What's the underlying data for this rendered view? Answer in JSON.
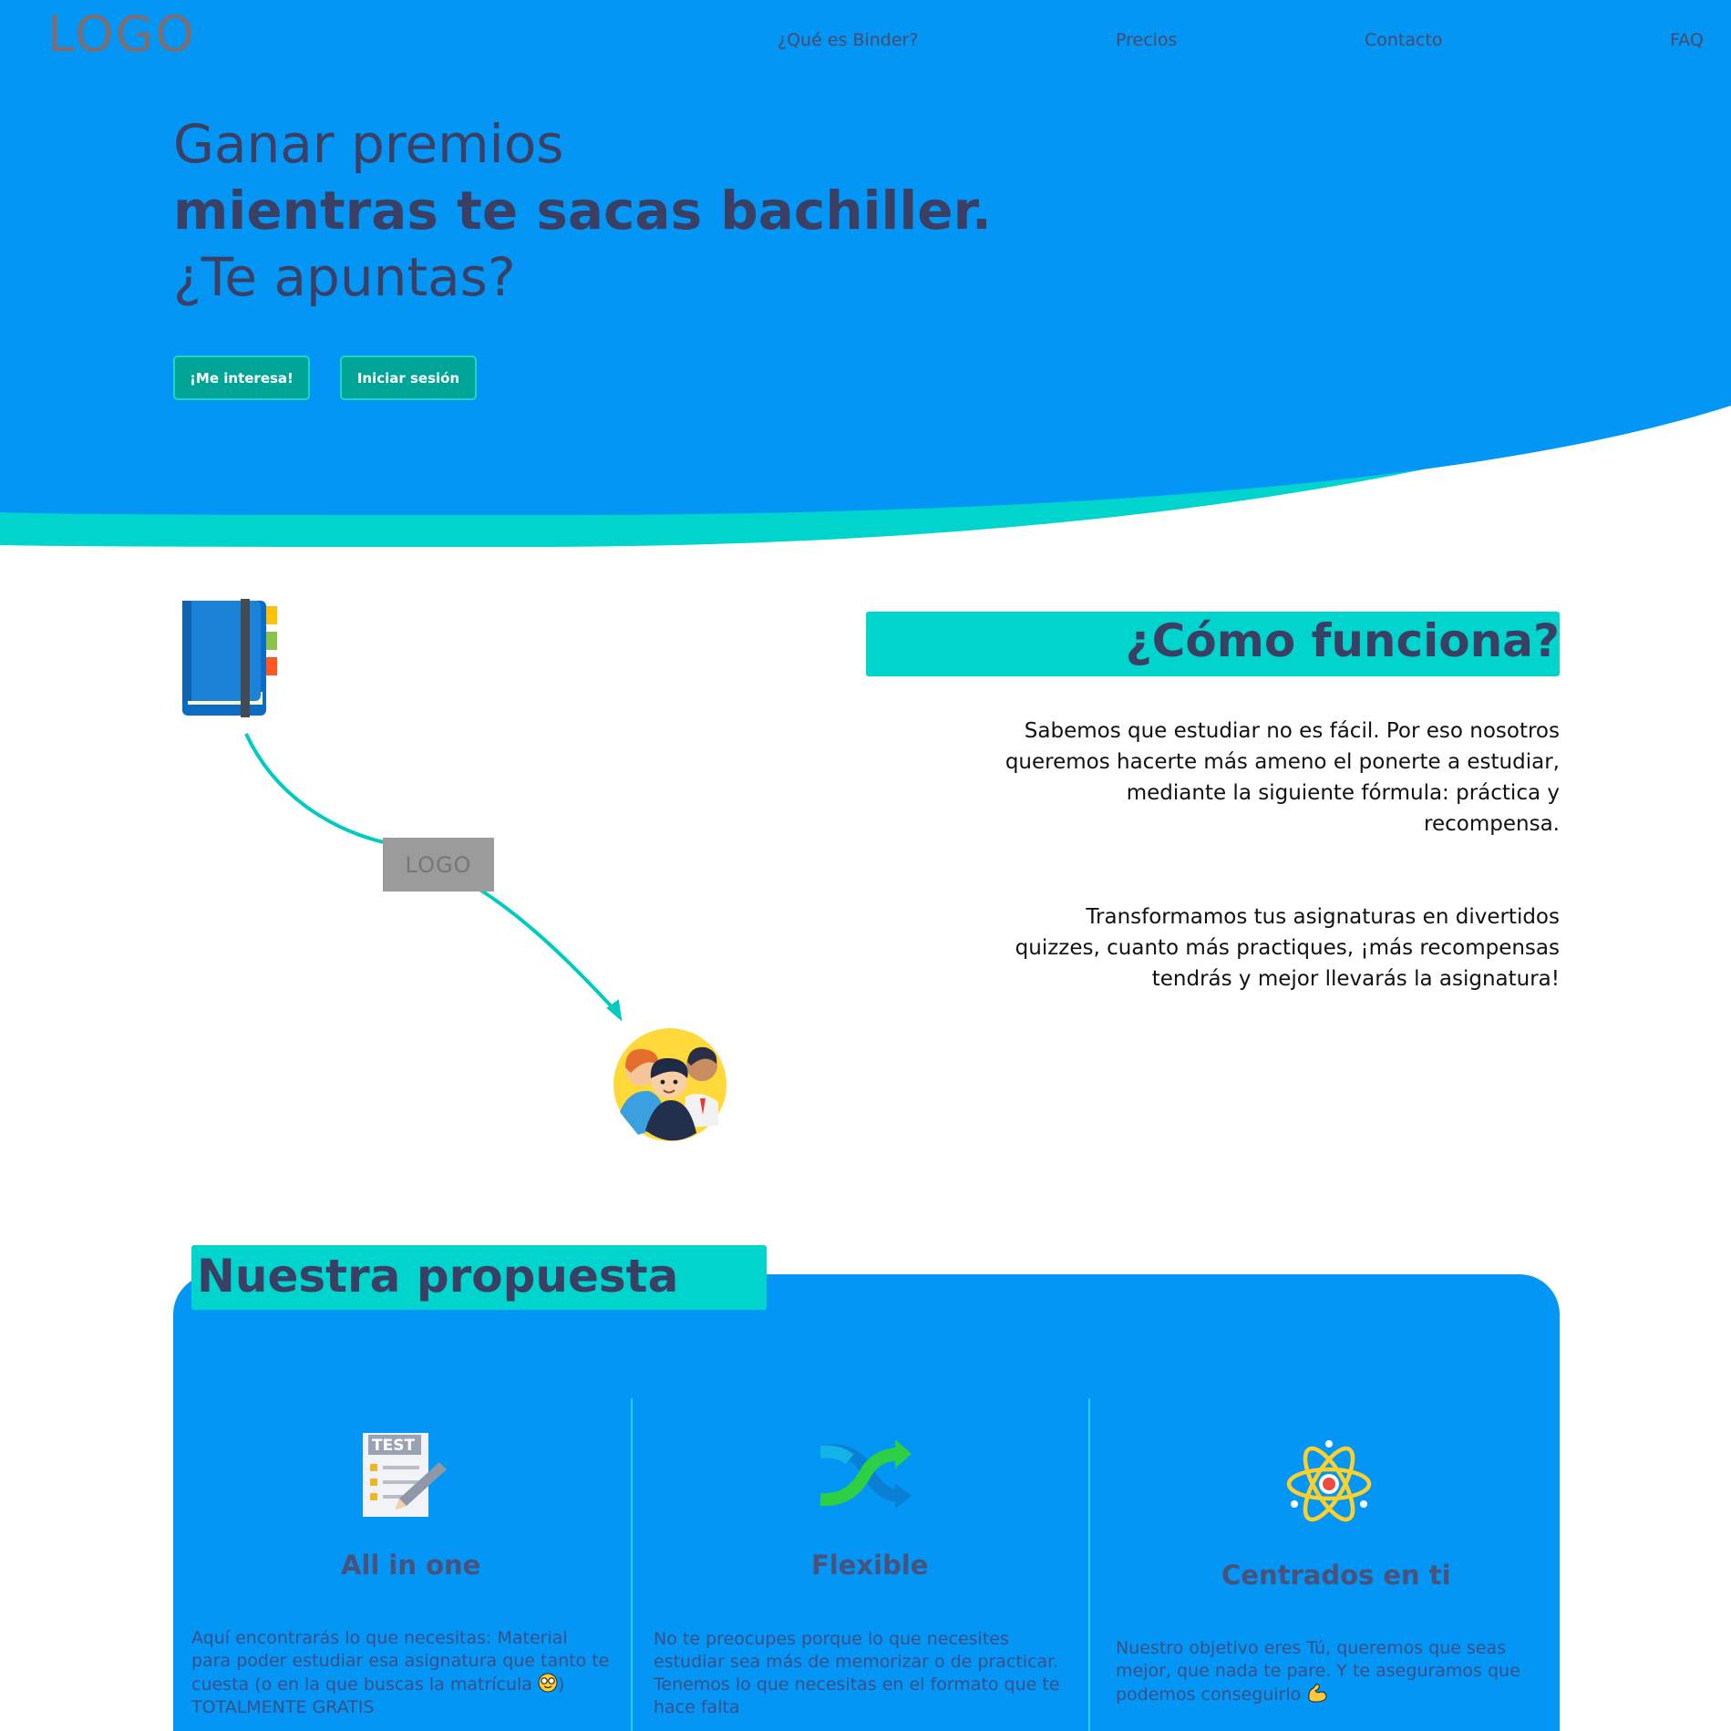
{
  "header": {
    "logo": "LOGO",
    "nav": [
      "¿Qué es Binder?",
      "Precios",
      "Contacto",
      "FAQ"
    ]
  },
  "hero": {
    "line1": "Ganar premios",
    "line2": "mientras te sacas bachiller.",
    "line3": "¿Te apuntas?",
    "buttons": [
      "¡Me interesa!",
      "Iniciar sesión"
    ]
  },
  "como_funciona": {
    "title": "¿Cómo funciona?",
    "paragraph1": "Sabemos que estudiar no es fácil. Por eso nosotros queremos hacerte más ameno el ponerte a estudiar, mediante la siguiente fórmula: práctica y recompensa.",
    "paragraph2": "Transformamos tus asignaturas en divertidos quizzes, cuanto más practiques, ¡más recompensas tendrás y mejor llevarás la asignatura!",
    "diagram_logo": "LOGO"
  },
  "propuesta": {
    "title": "Nuestra propuesta",
    "cards": [
      {
        "title": "All in one",
        "text": "Aquí encontrarás lo que necesitas: Material para poder estudiar esa asignatura que tanto te cuesta (o en la que buscas la matrícula",
        "text_end": ") TOTALMENTE GRATIS",
        "icon": "test-sheet-icon"
      },
      {
        "title": "Flexible",
        "text": "No te preocupes porque lo que necesites estudiar sea más de memorizar o de practicar. Tenemos lo que necesitas en el formato que te hace falta",
        "icon": "shuffle-arrows-icon"
      },
      {
        "title": "Centrados en ti",
        "text": "Nuestro objetivo eres Tú, queremos que seas mejor, que nada te pare. Y te aseguramos que podemos conseguirlo",
        "icon": "atom-icon"
      }
    ]
  },
  "colors": {
    "hero_blue": "#0496f5",
    "accent_teal": "#00d4cc",
    "button_teal": "#00a598",
    "heading_navy": "#3c3f64"
  }
}
